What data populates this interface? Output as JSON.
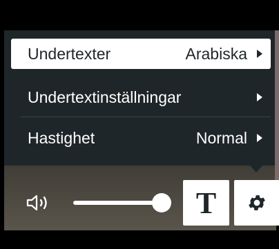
{
  "menu": {
    "items": [
      {
        "label": "Undertexter",
        "value": "Arabiska",
        "selected": true
      },
      {
        "label": "Undertextinställningar",
        "value": "",
        "selected": false
      },
      {
        "label": "Hastighet",
        "value": "Normal",
        "selected": false
      }
    ]
  },
  "controls": {
    "volume_level": 1.0,
    "captions_glyph": "T",
    "volume_icon": "speaker-icon",
    "settings_icon": "gear-icon"
  },
  "colors": {
    "menu_bg": "#1f2629",
    "selected_bg": "#ffffff",
    "text": "#ffffff"
  }
}
